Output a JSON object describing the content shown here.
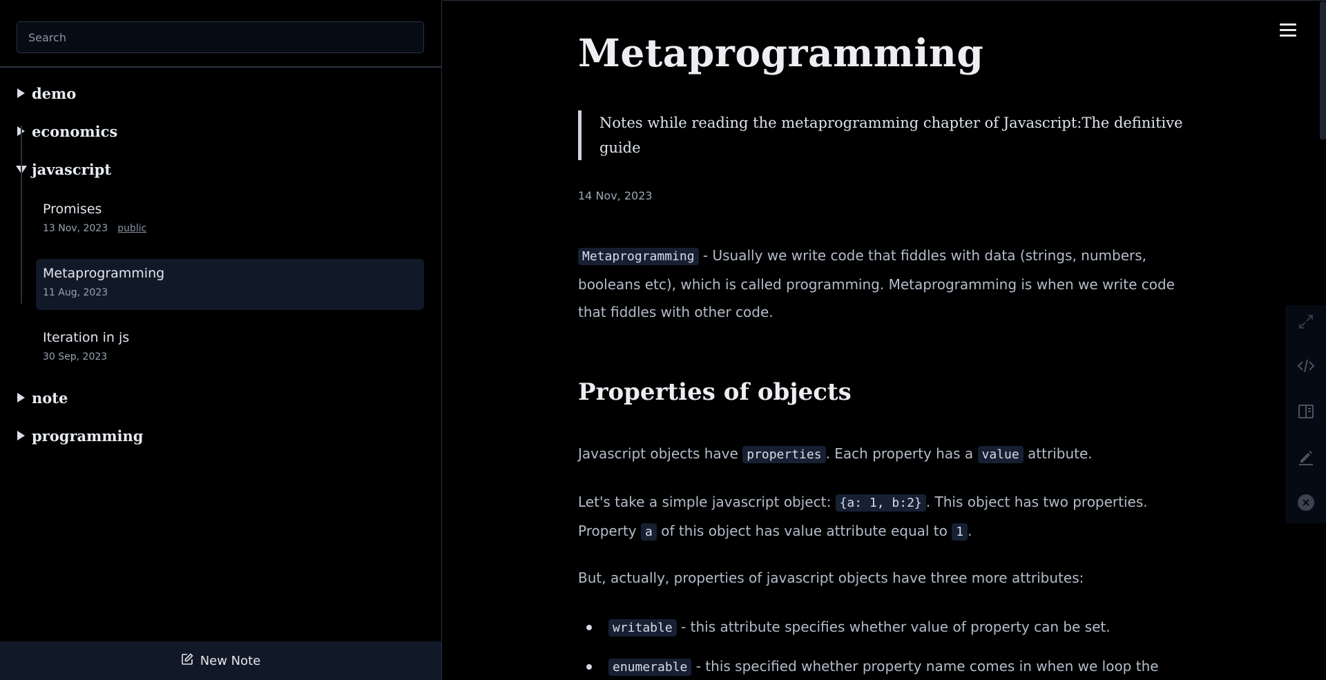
{
  "sidebar": {
    "search": {
      "placeholder": "Search"
    },
    "folders": [
      {
        "label": "demo",
        "expanded": false
      },
      {
        "label": "economics",
        "expanded": false
      },
      {
        "label": "javascript",
        "expanded": true
      },
      {
        "label": "note",
        "expanded": false
      },
      {
        "label": "programming",
        "expanded": false
      }
    ],
    "notes": [
      {
        "title": "Promises",
        "date": "13 Nov, 2023",
        "tag": "public",
        "active": false
      },
      {
        "title": "Metaprogramming",
        "date": "11 Aug, 2023",
        "active": true
      },
      {
        "title": "Iteration in js",
        "date": "30 Sep, 2023",
        "active": false
      }
    ],
    "new_note_label": "New Note"
  },
  "article": {
    "title": "Metaprogramming",
    "quote": "Notes while reading the metaprogramming chapter of Javascript:The definitive guide",
    "date": "14 Nov, 2023",
    "intro": {
      "code": "Metaprogramming",
      "text": " - Usually we write code that fiddles with data (strings, numbers, booleans etc), which is called programming. Metaprogramming is when we write code that fiddles with other code."
    },
    "heading": "Properties of objects",
    "p1": {
      "t1": "Javascript objects have ",
      "c1": "properties",
      "t2": ". Each property has a ",
      "c2": "value",
      "t3": " attribute."
    },
    "p2": {
      "t1": "Let's take a simple javascript object: ",
      "c1": "{a: 1, b:2}",
      "t2": ". This object has two properties. Property ",
      "c2": "a",
      "t3": " of this object has value attribute equal to ",
      "c3": "1",
      "t4": "."
    },
    "p3": "But, actually, properties of javascript objects have three more attributes:",
    "list": [
      {
        "code": "writable",
        "text": " - this attribute specifies whether value of property can be set."
      },
      {
        "code": "enumerable",
        "text": " - this specified whether property name comes in when we loop the"
      }
    ]
  },
  "toolbar": {
    "icons": [
      "expand-icon",
      "code-icon",
      "split-view-icon",
      "edit-icon",
      "close-icon"
    ]
  },
  "colors": {
    "background": "#000000",
    "sidebar_active": "#111827",
    "code_bg": "#172033",
    "text_body": "#b5bdca",
    "text_heading": "#eceef2"
  }
}
